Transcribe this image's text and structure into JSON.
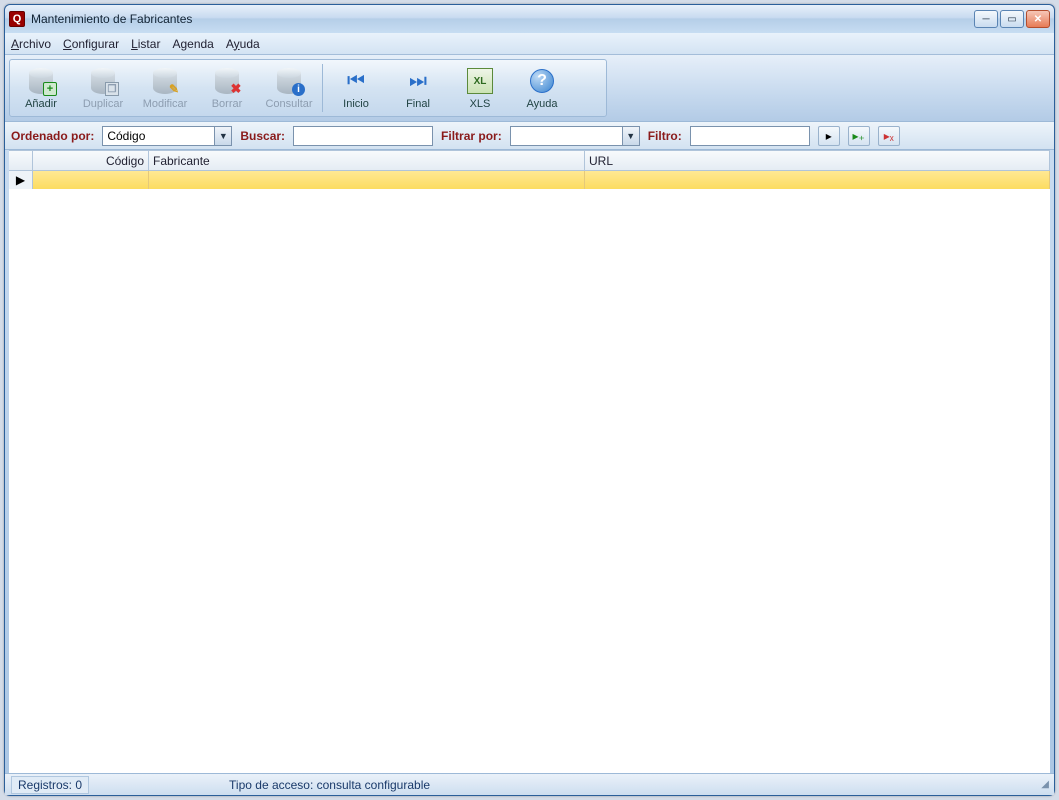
{
  "window": {
    "title": "Mantenimiento de Fabricantes"
  },
  "menu": {
    "archivo": "Archivo",
    "configurar": "Configurar",
    "listar": "Listar",
    "agenda": "Agenda",
    "ayuda": "Ayuda"
  },
  "toolbar": {
    "anadir": "Añadir",
    "duplicar": "Duplicar",
    "modificar": "Modificar",
    "borrar": "Borrar",
    "consultar": "Consultar",
    "inicio": "Inicio",
    "final": "Final",
    "xls": "XLS",
    "ayuda": "Ayuda"
  },
  "filter": {
    "ordenado_label": "Ordenado por:",
    "ordenado_value": "Código",
    "buscar_label": "Buscar:",
    "buscar_value": "",
    "filtrar_label": "Filtrar por:",
    "filtrar_value": "",
    "filtro_label": "Filtro:",
    "filtro_value": ""
  },
  "grid": {
    "col_codigo": "Código",
    "col_fabricante": "Fabricante",
    "col_url": "URL"
  },
  "status": {
    "registros": "Registros: 0",
    "acceso": "Tipo de acceso: consulta configurable"
  }
}
